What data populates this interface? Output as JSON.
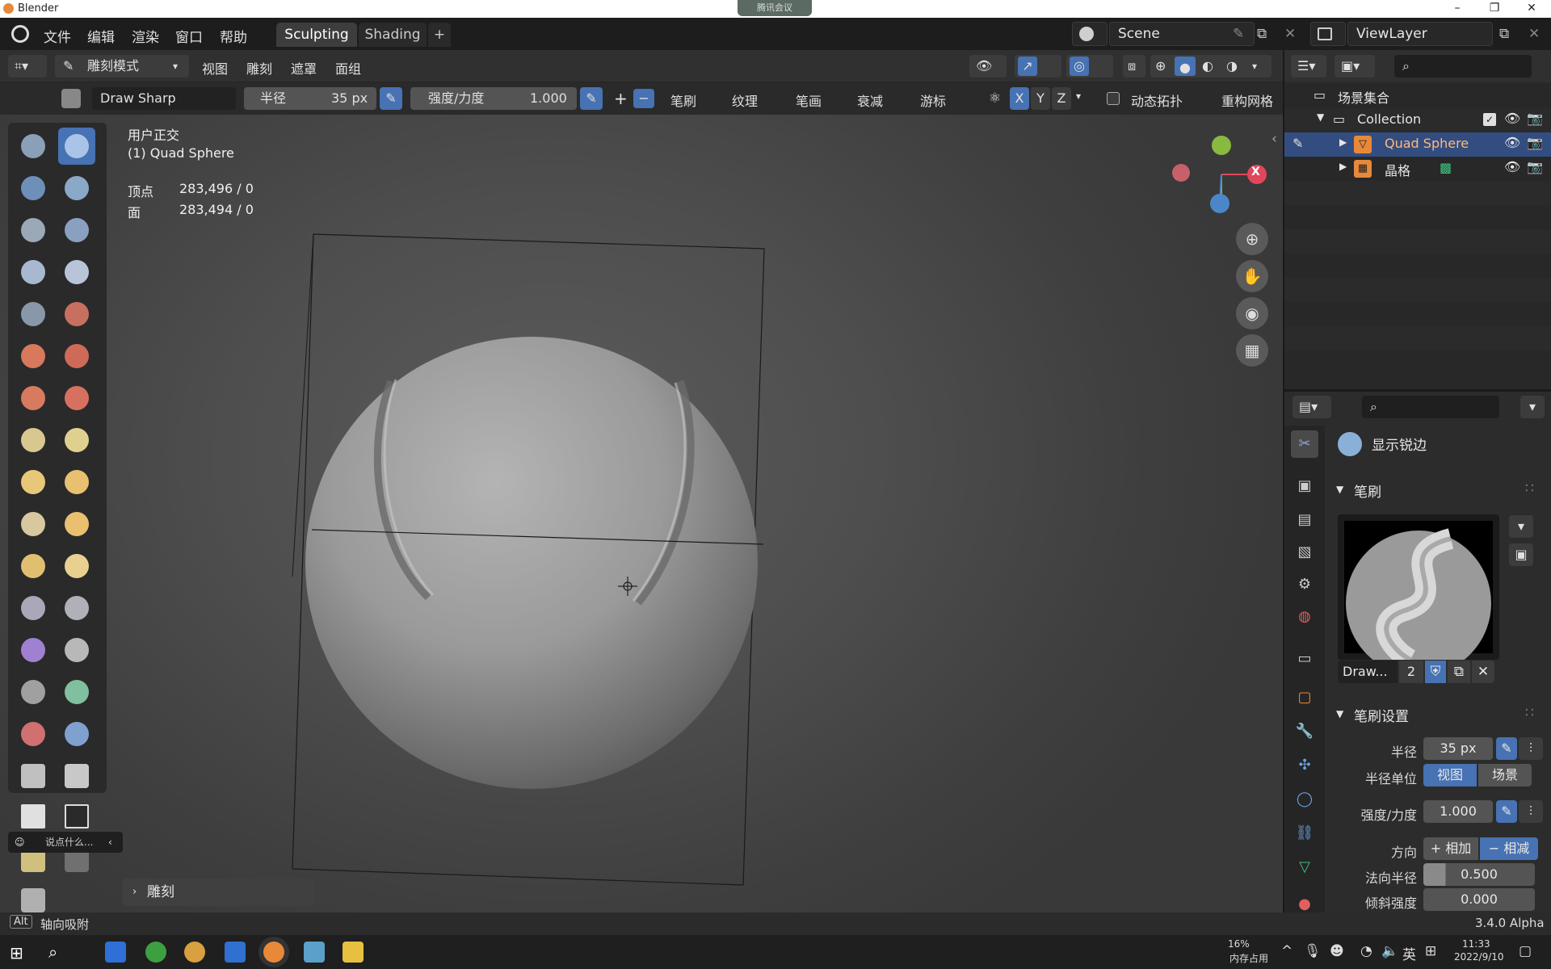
{
  "window": {
    "title": "Blender",
    "overlay_badge": "腾讯会议"
  },
  "menu": {
    "items": [
      "文件",
      "编辑",
      "渲染",
      "窗口",
      "帮助"
    ]
  },
  "workspaces": {
    "tabs": [
      "Sculpting",
      "Shading"
    ],
    "add_label": "+"
  },
  "scene": {
    "name": "Scene",
    "view_layer": "ViewLayer"
  },
  "header": {
    "mode": "雕刻模式",
    "menus": [
      "视图",
      "雕刻",
      "遮罩",
      "面组"
    ]
  },
  "tool_header": {
    "brush_name": "Draw Sharp",
    "radius_label": "半径",
    "radius_value": "35 px",
    "strength_label": "强度/力度",
    "strength_value": "1.000",
    "plus": "+",
    "minus": "−",
    "dropdowns": [
      "笔刷",
      "纹理",
      "笔画",
      "衰减",
      "游标"
    ],
    "axes": [
      "X",
      "Y",
      "Z"
    ],
    "dyntopo_label": "动态拓扑",
    "remesh_label": "重构网格"
  },
  "viewport": {
    "view_name": "用户正交",
    "object_name": "(1) Quad Sphere",
    "stats": [
      {
        "label": "顶点",
        "value": "283,496 / 0"
      },
      {
        "label": "面",
        "value": "283,494 / 0"
      }
    ],
    "gizmo_x": "X",
    "chat_placeholder": "说点什么...",
    "last_op_label": "雕刻"
  },
  "outliner": {
    "root": "场景集合",
    "collection": "Collection",
    "items": [
      "Quad Sphere",
      "晶格"
    ]
  },
  "properties": {
    "active_brush_label": "显示锐边",
    "panel_brush": "笔刷",
    "brush_datablock": "Draw...",
    "brush_users": "2",
    "panel_settings": "笔刷设置",
    "radius_label": "半径",
    "radius_value": "35 px",
    "radius_unit_label": "半径单位",
    "unit_view": "视图",
    "unit_scene": "场景",
    "strength_label": "强度/力度",
    "strength_value": "1.000",
    "direction_label": "方向",
    "dir_add": "+ 相加",
    "dir_sub": "− 相减",
    "normal_radius_label": "法向半径",
    "normal_radius_value": "0.500",
    "hardness_label": "倾斜强度",
    "hardness_value": "0.000"
  },
  "statusbar": {
    "key": "Alt",
    "hint": "轴向吸附",
    "version": "3.4.0 Alpha"
  },
  "taskbar": {
    "mem_percent": "16%",
    "mem_label": "内存占用",
    "ime": "英",
    "time": "11:33",
    "date": "2022/9/10"
  },
  "colors": {
    "accent": "#4772b3",
    "active_blue": "#5680c2",
    "x_axis": "#e0475a",
    "y_axis": "#8ab940",
    "z_axis": "#4b87c8",
    "orange": "#e8893a"
  }
}
